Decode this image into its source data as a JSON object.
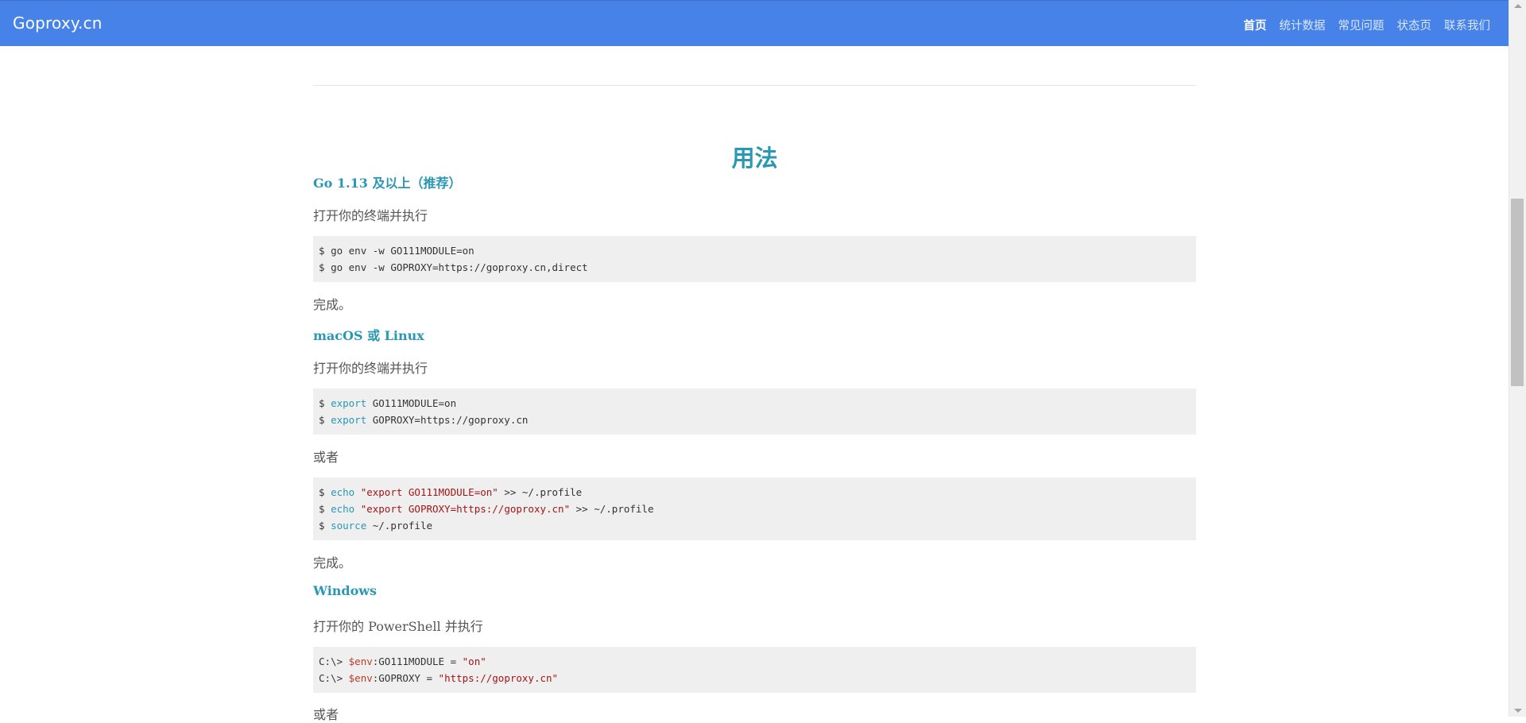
{
  "navbar": {
    "brand": "Goproxy.cn",
    "links": [
      {
        "label": "首页",
        "active": true
      },
      {
        "label": "统计数据",
        "active": false
      },
      {
        "label": "常见问题",
        "active": false
      },
      {
        "label": "状态页",
        "active": false
      },
      {
        "label": "联系我们",
        "active": false
      }
    ]
  },
  "main": {
    "section_title": "用法",
    "go113": {
      "heading": "Go 1.13 及以上（推荐）",
      "intro": "打开你的终端并执行",
      "code": [
        {
          "prompt": "$ ",
          "cmd": "go env -w GO111MODULE=on"
        },
        {
          "prompt": "$ ",
          "cmd": "go env -w GOPROXY=https://goproxy.cn,direct"
        }
      ],
      "done": "完成。"
    },
    "unix": {
      "heading": "macOS 或 Linux",
      "intro": "打开你的终端并执行",
      "code1": [
        {
          "prompt": "$ ",
          "kw": "export",
          "rest": " GO111MODULE=on"
        },
        {
          "prompt": "$ ",
          "kw": "export",
          "rest": " GOPROXY=https://goproxy.cn"
        }
      ],
      "or": "或者",
      "code2": [
        {
          "prompt": "$ ",
          "kw": "echo",
          "str": "\"export GO111MODULE=on\"",
          "rest": " >> ~/.profile"
        },
        {
          "prompt": "$ ",
          "kw": "echo",
          "str": "\"export GOPROXY=https://goproxy.cn\"",
          "rest": " >> ~/.profile"
        },
        {
          "prompt": "$ ",
          "kw": "source",
          "str": "",
          "rest": " ~/.profile"
        }
      ],
      "done": "完成。"
    },
    "windows": {
      "heading": "Windows",
      "intro": "打开你的 PowerShell 并执行",
      "code": [
        {
          "prompt": "C:\\> ",
          "var": "$env",
          "mid": ":GO111MODULE = ",
          "str": "\"on\""
        },
        {
          "prompt": "C:\\> ",
          "var": "$env",
          "mid": ":GOPROXY = ",
          "str": "\"https://goproxy.cn\""
        }
      ],
      "or": "或者"
    }
  },
  "colors": {
    "navbar": "#4682e8",
    "heading": "#2a97b3",
    "code_bg": "#efefef"
  }
}
